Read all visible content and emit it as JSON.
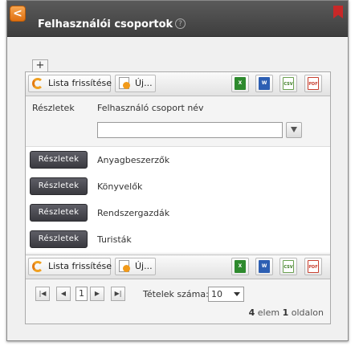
{
  "window": {
    "title": "Felhasználói csoportok",
    "back_glyph": "<",
    "help_glyph": "?"
  },
  "tabs": {
    "add_label": "+"
  },
  "toolbar": {
    "refresh_label": "Lista frissítése",
    "new_label": "Új...",
    "exports": [
      "xls-icon",
      "doc-icon",
      "csv-icon",
      "pdf-icon"
    ],
    "xls_text": "X",
    "doc_text": "W",
    "csv_text": "CSV",
    "pdf_text": "PDF"
  },
  "table": {
    "col_details": "Részletek",
    "col_name": "Felhasználó csoport név",
    "filter_value": "",
    "rows": [
      {
        "button": "Részletek",
        "name": "Anyagbeszerzők"
      },
      {
        "button": "Részletek",
        "name": "Könyvelők"
      },
      {
        "button": "Részletek",
        "name": "Rendszergazdák"
      },
      {
        "button": "Részletek",
        "name": "Turisták"
      }
    ]
  },
  "pager": {
    "first": "|◀",
    "prev": "◀",
    "page": "1",
    "next": "▶",
    "last": "▶|",
    "page_size_label": "Tételek száma:",
    "page_size": "10",
    "info_count": "4",
    "info_mid": " elem ",
    "info_page": "1",
    "info_end": " oldalon"
  },
  "colors": {
    "titlebar": "#4a4a4a",
    "accent": "#e8801a",
    "row_button": "#45454b"
  }
}
